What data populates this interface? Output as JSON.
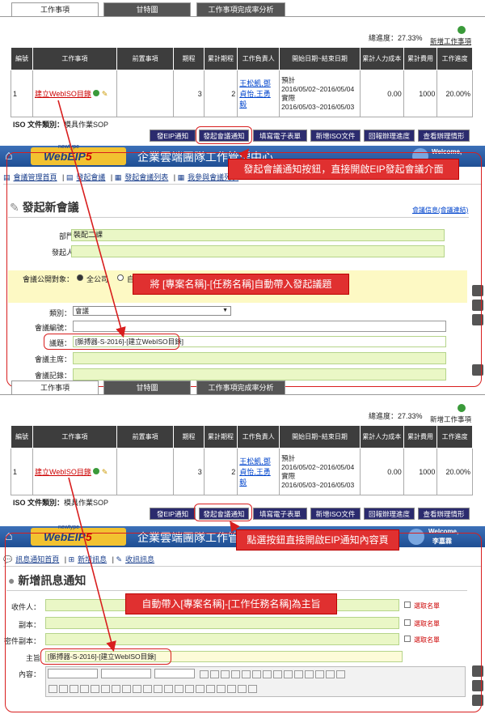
{
  "tabs": [
    "工作事項",
    "甘特圖",
    "工作事項完成率分析"
  ],
  "progress": {
    "label": "總進度：",
    "value": "27.33%"
  },
  "add_task": "新增工作事項",
  "table": {
    "headers": [
      "編號",
      "工作事項",
      "前置事項",
      "期程",
      "累計期程",
      "工作負責人",
      "開始日期~結束日期",
      "累計人力成本",
      "累計費用",
      "工作進度"
    ],
    "row": {
      "id": "1",
      "task": "建立WebISO目錄",
      "duration": "3",
      "cum_duration": "2",
      "owner": "王松凱,鄧貞怡,王勇毅",
      "planned_label": "預計",
      "planned": "2016/05/02~2016/05/04",
      "actual_label": "實際",
      "actual": "2016/05/03~2016/05/03",
      "labor": "0.00",
      "cost": "1000",
      "percent": "20.00%"
    }
  },
  "iso": {
    "label": "ISO 文件類別：",
    "value": "模具作業SOP"
  },
  "buttons": [
    "發EIP通知",
    "發起會議通知",
    "填寫電子表單",
    "新增ISO文件",
    "回報辦理進度",
    "查看辦理情形"
  ],
  "app": {
    "title": "企業雲端團隊工作管理中心",
    "title_partial": "企業雲端團隊工作管理中",
    "newtype": "newtype",
    "logo": "WebEIP",
    "version": "5",
    "welcome": "Welcome,",
    "user": "李嘉霖"
  },
  "meeting": {
    "nav": [
      "會議管理首頁",
      "發起會議",
      "發起會議列表",
      "我參與會議列表"
    ],
    "title": "發起新會議",
    "link": "會議信息(會議連結)",
    "dept_label": "部門：",
    "dept": "裝配二課",
    "sponsor_label": "發起人：",
    "public_label": "會議公開對象：",
    "public_all": "全公司",
    "public_other": "自",
    "category_label": "類別：",
    "category": "會議",
    "code_label": "會議編號：",
    "topic_label": "議題：",
    "topic": "[脈搏器-S-2016]-[建立WebISO目錄]",
    "chair_label": "會議主席：",
    "record_label": "會議記錄："
  },
  "notice": {
    "nav": [
      "訊息通知首頁",
      "新增訊息",
      "收訊訊息"
    ],
    "title": "新增訊息通知",
    "to_label": "收件人：",
    "cc_label": "副本：",
    "bcc_label": "密件副本：",
    "subject_label": "主旨",
    "content_label": "內容：",
    "subject": "[脈搏器-S-2016]-[建立WebISO目錄]",
    "pick": "選取名單"
  },
  "callouts": {
    "c1": "發起會議通知按鈕，直接開啟EIP發起會議介面",
    "c2": "將 [專案名稱]-[任務名稱]自動帶入發起議題",
    "c3": "點選按鈕直接開啟EIP通知內容頁",
    "c4": "自動帶入[專案名稱]-[工作任務名稱]為主旨"
  }
}
